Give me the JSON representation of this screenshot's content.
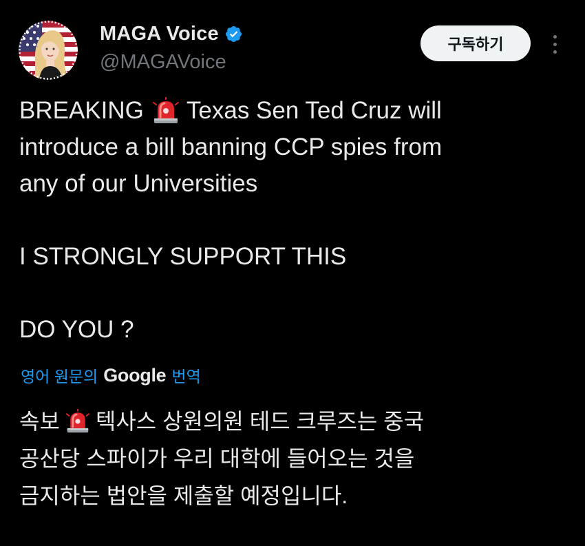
{
  "author": {
    "display_name": "MAGA Voice",
    "handle": "@MAGAVoice",
    "verified_icon": "verified-badge-icon",
    "verified_color": "#1d9bf0"
  },
  "subscribe_label": "구독하기",
  "more_icon": "more-options-icon",
  "post": {
    "lines": [
      {
        "before": "BREAKING",
        "after": "Texas Sen Ted Cruz will"
      },
      "introduce a bill banning CCP spies from",
      "any of our Universities",
      "I STRONGLY SUPPORT THIS",
      "DO YOU ?"
    ],
    "emoji": "rotating-light-siren-icon"
  },
  "translation": {
    "prefix": "영어 원문의",
    "provider": "Google",
    "suffix": "번역",
    "link_color": "#1d9bf0"
  },
  "translated_text": {
    "lines": [
      {
        "before": "속보",
        "after": "텍사스 상원의원 테드 크루즈는 중국"
      },
      "공산당 스파이가 우리 대학에 들어오는 것을",
      "금지하는 법안을 제출할 예정입니다."
    ]
  },
  "colors": {
    "background": "#000000",
    "text_primary": "#e7e9ea",
    "text_secondary": "#71767b",
    "button_bg": "#eff3f4"
  }
}
